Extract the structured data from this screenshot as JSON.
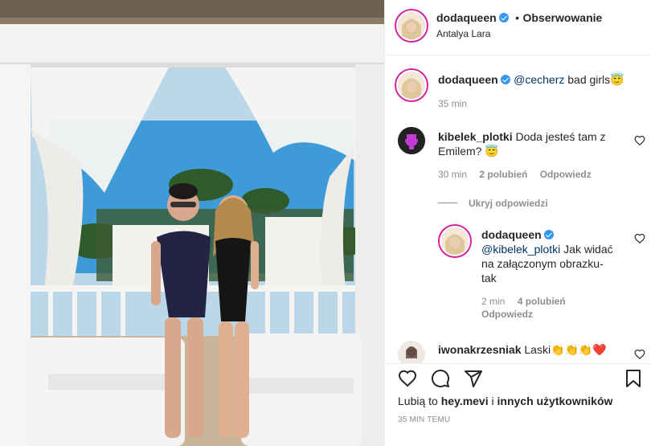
{
  "header": {
    "username": "dodaqueen",
    "separator": "•",
    "follow_label": "Obserwowanie",
    "location": "Antalya Lara"
  },
  "caption": {
    "username": "dodaqueen",
    "mention": "@cecherz",
    "text": " bad girls",
    "emoji": "😇",
    "time": "35 min"
  },
  "comments": [
    {
      "username": "kibelek_plotki",
      "text": "Doda jesteś tam z Emilem? 😇",
      "time": "30 min",
      "likes": "2 polubień",
      "reply_label": "Odpowiedz"
    }
  ],
  "hide_replies_label": "Ukryj odpowiedzi",
  "reply": {
    "username": "dodaqueen",
    "mention": "@kibelek_plotki",
    "text": " Jak widać na załączonym obrazku-tak",
    "time": "2 min",
    "likes": "4 polubień",
    "reply_label": "Odpowiedz"
  },
  "comment2": {
    "username": "iwonakrzesniak",
    "text": "Laski👏👏👏❤️"
  },
  "likes_line": {
    "prefix": "Lubią to ",
    "user": "hey.mevi",
    "middle": " i ",
    "others": "innych użytkowników"
  },
  "timestamp": "35 MIN TEMU",
  "icons": [
    "heart-icon",
    "comment-icon",
    "share-icon",
    "bookmark-icon"
  ],
  "colors": {
    "verified": "#3897f0",
    "story_ring": "#d6249f",
    "muted": "#8e8e8e",
    "link": "#00376b"
  }
}
